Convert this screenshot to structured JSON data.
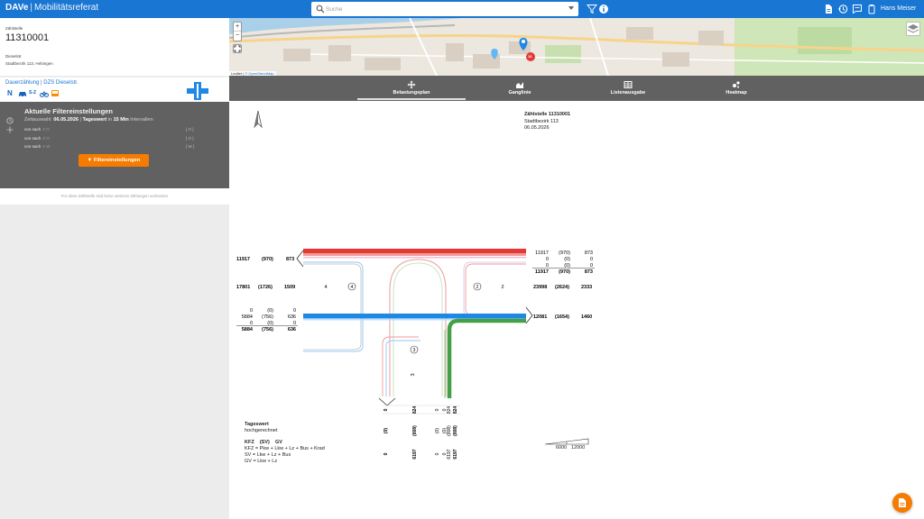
{
  "header": {
    "brand": "DAVe",
    "brand_sep": "|",
    "brand_sub": "Mobilitätsreferat",
    "search_placeholder": "Suche",
    "user_name": "Hans Meiser",
    "bar_color": "#1976d2"
  },
  "site": {
    "label": "Zählstelle",
    "id": "11310001",
    "name": "Dieselstr.",
    "district": "Stadtbezirk 113, Hebingen"
  },
  "count_type": {
    "link_text": "Dauerzählung | DZS Dieselstr.",
    "modes": [
      "N",
      "car-icon",
      "bike-icon",
      "pedestrian-icon",
      "bus-icon"
    ],
    "modes_badge": "S-Z"
  },
  "filter": {
    "title": "Aktuelle Filtereinstellungen",
    "line_prefix": "Zeitauswahl:",
    "date": "06.05.2026",
    "line_sep": "|",
    "value_type": "Tageswert",
    "line_mid": "in",
    "interval": "15 Min",
    "line_suffix": "Intervallen",
    "rows": [
      {
        "label": "von nach",
        "placeholder": "Z O",
        "count": "[ O ]"
      },
      {
        "label": "von nach",
        "placeholder": "Z O",
        "count": "[ O ]"
      },
      {
        "label": "von nach",
        "placeholder": "Z W",
        "count": "[ W ]"
      }
    ],
    "button_label": "Filtereinstellungen",
    "note": "Für diese Zählstelle sind keine weiteren Zählungen vorhanden",
    "button_color": "#f57c00"
  },
  "map": {
    "attribution_leaflet": "Leaflet",
    "attribution_sep": "|",
    "attribution_osm": "© OpenStreetMap",
    "marker_badge": "16"
  },
  "tabs": [
    {
      "label": "Belastungsplan",
      "icon": "move-icon",
      "active": true
    },
    {
      "label": "Ganglinie",
      "icon": "area-chart-icon",
      "active": false
    },
    {
      "label": "Listenausgabe",
      "icon": "table-icon",
      "active": false
    },
    {
      "label": "Heatmap",
      "icon": "heatmap-icon",
      "active": false
    }
  ],
  "plan": {
    "header_title": "Zählstelle 11310001",
    "header_district": "Stadtbezirk 113",
    "header_date": "06.05.2026",
    "west": {
      "top": [
        "11917",
        "(970)",
        "873"
      ],
      "mid": [
        "17801",
        "(1726)",
        "1509"
      ],
      "arm_num": "4",
      "circle": "4",
      "rows": [
        [
          "0",
          "(0)",
          "0"
        ],
        [
          "5884",
          "(756)",
          "636"
        ],
        [
          "0",
          "(0)",
          "0"
        ]
      ],
      "total": [
        "5884",
        "(756)",
        "636"
      ]
    },
    "east": {
      "rows": [
        [
          "11917",
          "(970)",
          "873"
        ],
        [
          "0",
          "(0)",
          "0"
        ],
        [
          "0",
          "(0)",
          "0"
        ]
      ],
      "total": [
        "11917",
        "(970)",
        "873"
      ],
      "circle": "2",
      "arm_num": "2",
      "mid": [
        "23998",
        "(2624)",
        "2333"
      ],
      "out": [
        "12081",
        "(1654)",
        "1460"
      ]
    },
    "south": {
      "circle": "3",
      "arm_num": "3",
      "top": [
        "0",
        "824",
        "0",
        "0",
        "824",
        "824"
      ],
      "paren": [
        "(0)",
        "(808)",
        "(0)",
        "(0)",
        "(808)",
        "(808)"
      ],
      "bottom": [
        "0",
        "6197",
        "0",
        "0",
        "6197",
        "6197"
      ]
    },
    "colors": {
      "red": "#e53935",
      "blue": "#1e88e5",
      "green": "#43a047"
    },
    "legend": {
      "title": "Tageswert",
      "subtitle": "hochgerechnet",
      "cols": [
        "KFZ",
        "(SV)",
        "GV"
      ],
      "kfz": "KFZ = Pkw + Lkw + Lz + Bus + Krad",
      "sv": "SV = Lkw + Lz + Bus",
      "gv": "GV = Lkw + Lz"
    },
    "scale": {
      "a": "6000",
      "b": "12000"
    }
  }
}
